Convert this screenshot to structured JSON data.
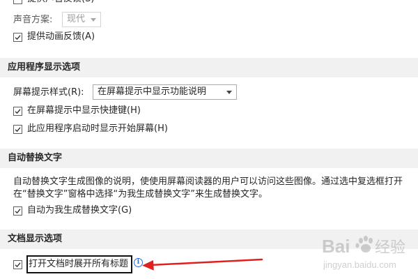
{
  "accessibility": {
    "sound_feedback_label": "提供声音反馈(S)",
    "sound_scheme_label": "声音方案:",
    "sound_scheme_value": "现代",
    "animation_feedback_label": "提供动画反馈(A)"
  },
  "app_display": {
    "title": "应用程序显示选项",
    "screentip_style_label": "屏幕提示样式(R):",
    "screentip_style_value": "在屏幕提示中显示功能说明",
    "show_shortcuts_label": "在屏幕提示中显示快捷键(H)",
    "show_start_screen_label": "此应用程序启动时显示开始屏幕(H)"
  },
  "alt_text": {
    "title": "自动替换文字",
    "description_line1": "自动替换文字生成图像的说明，使使用屏幕阅读器的用户可以访问这些图像。通过选中复选框打开",
    "description_line2": "在“替换文字”窗格中选择“为我生成替换文字”来生成替换文字。",
    "auto_generate_label": "自动为我生成替换文字(G)"
  },
  "doc_display": {
    "title": "文档显示选项",
    "expand_headings_label": "打开文档时展开所有标题"
  },
  "checkbox_states": {
    "sound_feedback": false,
    "animation_feedback": true,
    "show_shortcuts": true,
    "show_start_screen": true,
    "auto_generate_alt_text": true,
    "expand_headings": true
  },
  "colors": {
    "section_background": "#f1f1f1",
    "annotation_arrow": "#e02020",
    "info_icon": "#2a6ad8"
  },
  "icons": {
    "info": "info-icon",
    "annotation": "red-arrow"
  },
  "watermark": {
    "brand": "Baidu",
    "brand_cn": "经验",
    "url": "jingyan.baidu.com"
  }
}
